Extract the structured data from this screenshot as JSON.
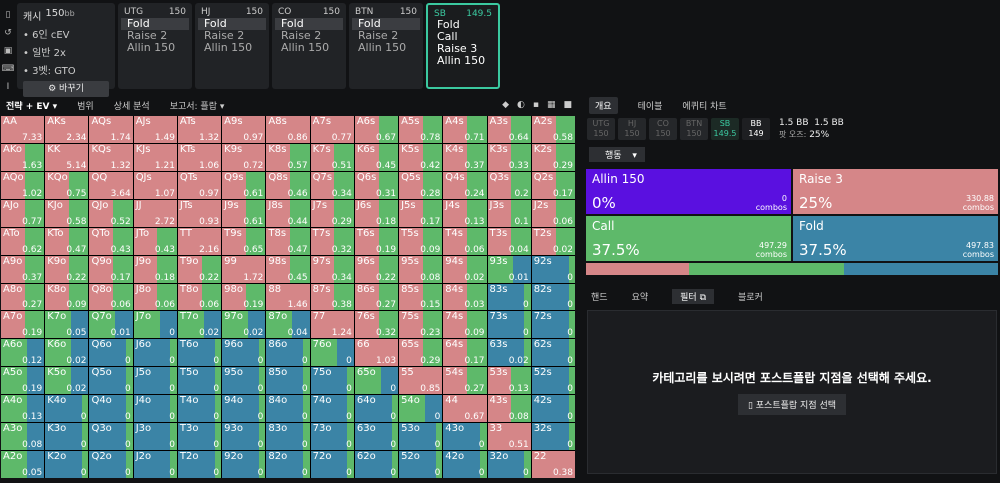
{
  "rail": [
    "bookmark-icon",
    "history-icon",
    "save-icon",
    "gamepad-icon",
    "text-cursor-icon"
  ],
  "config": {
    "game": "캐시",
    "stack": "150",
    "unit": "bb",
    "lines": [
      "6인 cEV",
      "일반 2x",
      "3벳: GTO"
    ],
    "change": "바꾸기"
  },
  "positions": [
    {
      "name": "UTG",
      "stack": "150",
      "actions": [
        "Fold",
        "Raise 2",
        "Allin 150"
      ],
      "sel": 0
    },
    {
      "name": "HJ",
      "stack": "150",
      "actions": [
        "Fold",
        "Raise 2",
        "Allin 150"
      ],
      "sel": 0
    },
    {
      "name": "CO",
      "stack": "150",
      "actions": [
        "Fold",
        "Raise 2",
        "Allin 150"
      ],
      "sel": 0
    },
    {
      "name": "BTN",
      "stack": "150",
      "actions": [
        "Fold",
        "Raise 2",
        "Allin 150"
      ],
      "sel": 0
    },
    {
      "name": "SB",
      "stack": "149.5",
      "actions": [
        "Fold",
        "Call",
        "Raise 3",
        "Allin 150"
      ],
      "sel": -1
    }
  ],
  "toolbar": {
    "t1": "전략 + EV",
    "t2": "범위",
    "t3": "상세 분석",
    "t4": "보고서: 플랍"
  },
  "grid": {
    "hands": [
      [
        "AA",
        "AKs",
        "AQs",
        "AJs",
        "ATs",
        "A9s",
        "A8s",
        "A7s",
        "A6s",
        "A5s",
        "A4s",
        "A3s",
        "A2s"
      ],
      [
        "AKo",
        "KK",
        "KQs",
        "KJs",
        "KTs",
        "K9s",
        "K8s",
        "K7s",
        "K6s",
        "K5s",
        "K4s",
        "K3s",
        "K2s"
      ],
      [
        "AQo",
        "KQo",
        "QQ",
        "QJs",
        "QTs",
        "Q9s",
        "Q8s",
        "Q7s",
        "Q6s",
        "Q5s",
        "Q4s",
        "Q3s",
        "Q2s"
      ],
      [
        "AJo",
        "KJo",
        "QJo",
        "JJ",
        "JTs",
        "J9s",
        "J8s",
        "J7s",
        "J6s",
        "J5s",
        "J4s",
        "J3s",
        "J2s"
      ],
      [
        "ATo",
        "KTo",
        "QTo",
        "JTo",
        "TT",
        "T9s",
        "T8s",
        "T7s",
        "T6s",
        "T5s",
        "T4s",
        "T3s",
        "T2s"
      ],
      [
        "A9o",
        "K9o",
        "Q9o",
        "J9o",
        "T9o",
        "99",
        "98s",
        "97s",
        "96s",
        "95s",
        "94s",
        "93s",
        "92s"
      ],
      [
        "A8o",
        "K8o",
        "Q8o",
        "J8o",
        "T8o",
        "98o",
        "88",
        "87s",
        "86s",
        "85s",
        "84s",
        "83s",
        "82s"
      ],
      [
        "A7o",
        "K7o",
        "Q7o",
        "J7o",
        "T7o",
        "97o",
        "87o",
        "77",
        "76s",
        "75s",
        "74s",
        "73s",
        "72s"
      ],
      [
        "A6o",
        "K6o",
        "Q6o",
        "J6o",
        "T6o",
        "96o",
        "86o",
        "76o",
        "66",
        "65s",
        "64s",
        "63s",
        "62s"
      ],
      [
        "A5o",
        "K5o",
        "Q5o",
        "J5o",
        "T5o",
        "95o",
        "85o",
        "75o",
        "65o",
        "55",
        "54s",
        "53s",
        "52s"
      ],
      [
        "A4o",
        "K4o",
        "Q4o",
        "J4o",
        "T4o",
        "94o",
        "84o",
        "74o",
        "64o",
        "54o",
        "44",
        "43s",
        "42s"
      ],
      [
        "A3o",
        "K3o",
        "Q3o",
        "J3o",
        "T3o",
        "93o",
        "83o",
        "73o",
        "63o",
        "53o",
        "43o",
        "33",
        "32s"
      ],
      [
        "A2o",
        "K2o",
        "Q2o",
        "J2o",
        "T2o",
        "92o",
        "82o",
        "72o",
        "62o",
        "52o",
        "42o",
        "32o",
        "22"
      ]
    ],
    "ev": [
      [
        "7.33",
        "2.34",
        "1.74",
        "1.49",
        "1.32",
        "0.97",
        "0.86",
        "0.77",
        "0.67",
        "0.78",
        "0.71",
        "0.64",
        "0.58"
      ],
      [
        "1.63",
        "5.14",
        "1.32",
        "1.21",
        "1.06",
        "0.72",
        "0.57",
        "0.51",
        "0.45",
        "0.42",
        "0.37",
        "0.33",
        "0.29"
      ],
      [
        "1.02",
        "0.75",
        "3.64",
        "1.07",
        "0.97",
        "0.61",
        "0.46",
        "0.34",
        "0.31",
        "0.28",
        "0.24",
        "0.2",
        "0.17"
      ],
      [
        "0.77",
        "0.58",
        "0.52",
        "2.72",
        "0.93",
        "0.61",
        "0.44",
        "0.29",
        "0.18",
        "0.17",
        "0.13",
        "0.1",
        "0.06"
      ],
      [
        "0.62",
        "0.47",
        "0.43",
        "0.43",
        "2.16",
        "0.65",
        "0.47",
        "0.32",
        "0.19",
        "0.09",
        "0.06",
        "0.04",
        "0.02"
      ],
      [
        "0.37",
        "0.22",
        "0.17",
        "0.18",
        "0.22",
        "1.72",
        "0.45",
        "0.34",
        "0.22",
        "0.08",
        "0.02",
        "0.01",
        "0"
      ],
      [
        "0.27",
        "0.09",
        "0.06",
        "0.06",
        "0.06",
        "0.19",
        "1.46",
        "0.38",
        "0.27",
        "0.15",
        "0.03",
        "0",
        "0"
      ],
      [
        "0.19",
        "0.05",
        "0.01",
        "0",
        "0.02",
        "0.02",
        "0.04",
        "1.24",
        "0.32",
        "0.23",
        "0.09",
        "0",
        "0"
      ],
      [
        "0.12",
        "0.02",
        "0",
        "0",
        "0",
        "0",
        "0",
        "0",
        "1.03",
        "0.29",
        "0.17",
        "0.02",
        "0"
      ],
      [
        "0.19",
        "0.02",
        "0",
        "0",
        "0",
        "0",
        "0",
        "0",
        "0",
        "0.85",
        "0.27",
        "0.13",
        "0"
      ],
      [
        "0.13",
        "0",
        "0",
        "0",
        "0",
        "0",
        "0",
        "0",
        "0",
        "0",
        "0.67",
        "0.08",
        "0"
      ],
      [
        "0.08",
        "0",
        "0",
        "0",
        "0",
        "0",
        "0",
        "0",
        "0",
        "0",
        "0",
        "0.51",
        "0"
      ],
      [
        "0.05",
        "0",
        "0",
        "0",
        "0",
        "0",
        "0",
        "0",
        "0",
        "0",
        "0",
        "0",
        "0.38"
      ]
    ],
    "mix": [
      [
        "r",
        "r",
        "r",
        "r",
        "r",
        "r",
        "r",
        "r",
        "mr",
        "mr",
        "mr",
        "mr",
        "mr"
      ],
      [
        "mr",
        "r",
        "r",
        "r",
        "r",
        "r",
        "mr",
        "mr",
        "mr",
        "mr",
        "mr",
        "mr",
        "mr"
      ],
      [
        "mr",
        "mr",
        "r",
        "r",
        "r",
        "mr",
        "mr",
        "mr",
        "mr",
        "mr",
        "mr",
        "mr",
        "mr"
      ],
      [
        "mr",
        "mr",
        "mr",
        "r",
        "r",
        "mr",
        "mr",
        "mr",
        "mr",
        "mr",
        "mr",
        "mr",
        "mr"
      ],
      [
        "mr",
        "mr",
        "mr",
        "mr",
        "r",
        "mr",
        "mr",
        "mr",
        "mr",
        "mr",
        "mr",
        "mr",
        "mr"
      ],
      [
        "mr",
        "mr",
        "mr",
        "mr",
        "mr",
        "r",
        "mr",
        "mr",
        "mr",
        "mr",
        "mr",
        "c",
        "f"
      ],
      [
        "mr",
        "mr",
        "mr",
        "mr",
        "mr",
        "mr",
        "r",
        "mr",
        "mr",
        "mr",
        "mr",
        "f",
        "f"
      ],
      [
        "mr",
        "c",
        "c",
        "c",
        "c",
        "c",
        "c",
        "r",
        "mr",
        "mr",
        "mr",
        "f",
        "f"
      ],
      [
        "c",
        "c",
        "f",
        "f",
        "f",
        "f",
        "f",
        "c",
        "r",
        "mr",
        "mr",
        "f",
        "f"
      ],
      [
        "c",
        "c",
        "f",
        "f",
        "f",
        "f",
        "f",
        "f",
        "c",
        "r",
        "mr",
        "mr",
        "f"
      ],
      [
        "c",
        "f",
        "f",
        "f",
        "f",
        "f",
        "f",
        "f",
        "f",
        "c",
        "r",
        "mr",
        "f"
      ],
      [
        "c",
        "f",
        "f",
        "f",
        "f",
        "f",
        "f",
        "f",
        "f",
        "f",
        "f",
        "r",
        "f"
      ],
      [
        "c",
        "f",
        "f",
        "f",
        "f",
        "f",
        "f",
        "f",
        "f",
        "f",
        "f",
        "f",
        "mr"
      ]
    ]
  },
  "right": {
    "tabs": [
      "개요",
      "테이블",
      "에퀴티 차트"
    ],
    "strip": [
      "UTG",
      "HJ",
      "CO",
      "BTN",
      "SB",
      "BB"
    ],
    "strip_vals": [
      "150",
      "150",
      "150",
      "150",
      "149.5",
      "149"
    ],
    "pot": "1.5 BB",
    "pot2": "1.5 BB",
    "odds_label": "팟 오즈:",
    "odds": "25%",
    "action_label": "행동",
    "actions": [
      {
        "name": "Allin 150",
        "pct": "0%",
        "combos": "0",
        "unit": "combos",
        "color": "#5a10e0"
      },
      {
        "name": "Raise 3",
        "pct": "25%",
        "combos": "330.88",
        "unit": "combos",
        "color": "#d58688"
      },
      {
        "name": "Call",
        "pct": "37.5%",
        "combos": "497.29",
        "unit": "combos",
        "color": "#5eb96a"
      },
      {
        "name": "Fold",
        "pct": "37.5%",
        "combos": "497.83",
        "unit": "combos",
        "color": "#3b84a6"
      }
    ],
    "bar": [
      0.25,
      0.375,
      0.375
    ],
    "tabs2": [
      "핸드",
      "요약",
      "필터",
      "블로커"
    ],
    "filter_msg": "카테고리를 보시려면 포스트플랍 지점을 선택해 주세요.",
    "filter_btn": "포스트플랍 지점 선택"
  }
}
